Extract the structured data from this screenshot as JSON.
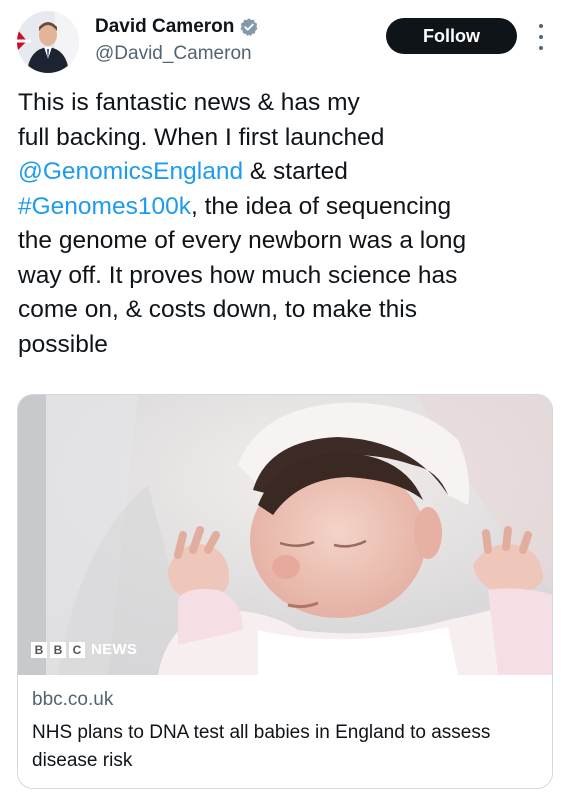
{
  "author": {
    "display_name": "David Cameron",
    "handle": "@David_Cameron",
    "verified_icon": "verified-badge-icon"
  },
  "actions": {
    "follow_label": "Follow",
    "more_icon": "more-vertical-icon"
  },
  "tweet": {
    "line1": "This is fantastic news & has my",
    "line2": "full backing. When I first launched",
    "mention": "@GenomicsEngland",
    "line3_rest": " & started",
    "hashtag": "#Genomes100k",
    "line4_rest": ", the idea of sequencing",
    "line5": "the genome of every newborn was a long",
    "line6": "way off. It proves how much science has",
    "line7": "come on, & costs down, to make this",
    "line8": "possible"
  },
  "card": {
    "logo_letters": [
      "B",
      "B",
      "C"
    ],
    "logo_word": "NEWS",
    "domain": "bbc.co.uk",
    "headline": "NHS plans to DNA test all babies in England to assess disease risk"
  },
  "colors": {
    "link": "#1d9bf0",
    "follow_bg": "#0f1419",
    "secondary_text": "#536471",
    "verified": "#829aab"
  }
}
